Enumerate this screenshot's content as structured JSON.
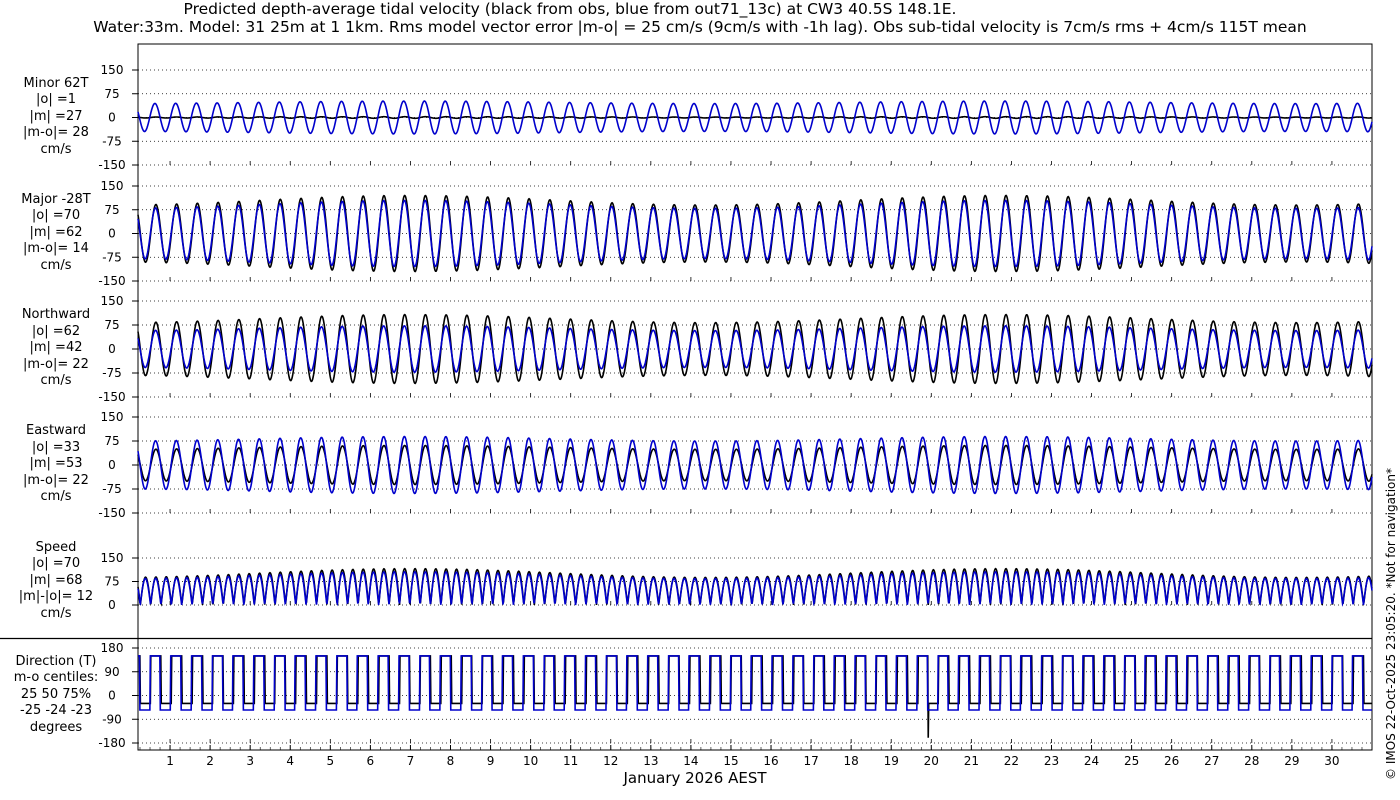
{
  "title_line1": "Predicted depth-average tidal velocity (black from obs, blue from out71_13c) at CW3 40.5S 148.1E.",
  "title_line2": "Water:33m. Model: 31 25m at 1 1km. Rms model vector error |m-o| = 25 cm/s (9cm/s with -1h lag). Obs sub-tidal velocity is 7cm/s rms + 4cm/s 115T mean",
  "credit": "© IMOS 22-Oct-2025 23:05:20. *Not for navigation*",
  "colors": {
    "obs": "#000000",
    "model": "#0000cc"
  },
  "chart_data": {
    "type": "line",
    "xlabel": "January 2026 AEST",
    "x_ticks": [
      "1",
      "2",
      "3",
      "4",
      "5",
      "6",
      "7",
      "8",
      "9",
      "10",
      "11",
      "12",
      "13",
      "14",
      "15",
      "16",
      "17",
      "18",
      "19",
      "20",
      "21",
      "22",
      "23",
      "24",
      "25",
      "26",
      "27",
      "28",
      "29",
      "30"
    ],
    "xlim": [
      0.2,
      31.0
    ],
    "series_names": [
      "obs",
      "model"
    ],
    "panels": [
      {
        "id": "minor",
        "label": [
          "Minor 62T",
          "|o| =1",
          "|m| =27",
          "|m-o|= 28",
          "cm/s"
        ],
        "ylim": [
          -150,
          150
        ],
        "yticks": [
          "-150",
          "-75",
          "0",
          "75",
          "150"
        ],
        "obs_amp": 2,
        "obs_amp_var": 1,
        "model_amp": 48,
        "model_amp_var": 8,
        "model_phase": 0.3
      },
      {
        "id": "major",
        "label": [
          "Major -28T",
          "|o| =70",
          "|m| =62",
          "|m-o|= 14",
          "cm/s"
        ],
        "ylim": [
          -150,
          150
        ],
        "yticks": [
          "-150",
          "-75",
          "0",
          "75",
          "150"
        ],
        "obs_amp": 105,
        "obs_amp_var": 30,
        "model_amp": 92,
        "model_amp_var": 25,
        "model_phase": 0.1
      },
      {
        "id": "north",
        "label": [
          "Northward",
          "|o| =62",
          "|m| =42",
          "|m-o|= 22",
          "cm/s"
        ],
        "ylim": [
          -150,
          150
        ],
        "yticks": [
          "-150",
          "-75",
          "0",
          "75",
          "150"
        ],
        "obs_amp": 95,
        "obs_amp_var": 25,
        "model_amp": 65,
        "model_amp_var": 15,
        "model_phase": 0.1
      },
      {
        "id": "east",
        "label": [
          "Eastward",
          "|o| =33",
          "|m| =53",
          "|m-o|= 22",
          "cm/s"
        ],
        "ylim": [
          -150,
          150
        ],
        "yticks": [
          "-150",
          "-75",
          "0",
          "75",
          "150"
        ],
        "obs_amp": 55,
        "obs_amp_var": 12,
        "model_amp": 82,
        "model_amp_var": 14,
        "model_phase": 0.1
      },
      {
        "id": "speed",
        "label": [
          "Speed",
          "|o| =70",
          "|m| =68",
          "|m|-|o|= 12",
          "cm/s"
        ],
        "ylim": [
          0,
          150
        ],
        "yticks": [
          "0",
          "75",
          "150"
        ],
        "obs_amp": 102,
        "obs_amp_var": 28,
        "model_amp": 95,
        "model_amp_var": 22,
        "model_phase": 0.05
      },
      {
        "id": "direction",
        "label": [
          "Direction (T)",
          "m-o centiles:",
          "25  50  75%",
          "-25 -24 -23",
          "degrees"
        ],
        "ylim": [
          -180,
          180
        ],
        "yticks": [
          "-180",
          "-90",
          "0",
          "90",
          "180"
        ],
        "obs_high": 150,
        "obs_low": -30,
        "model_high": 150,
        "model_low": -55
      }
    ]
  }
}
